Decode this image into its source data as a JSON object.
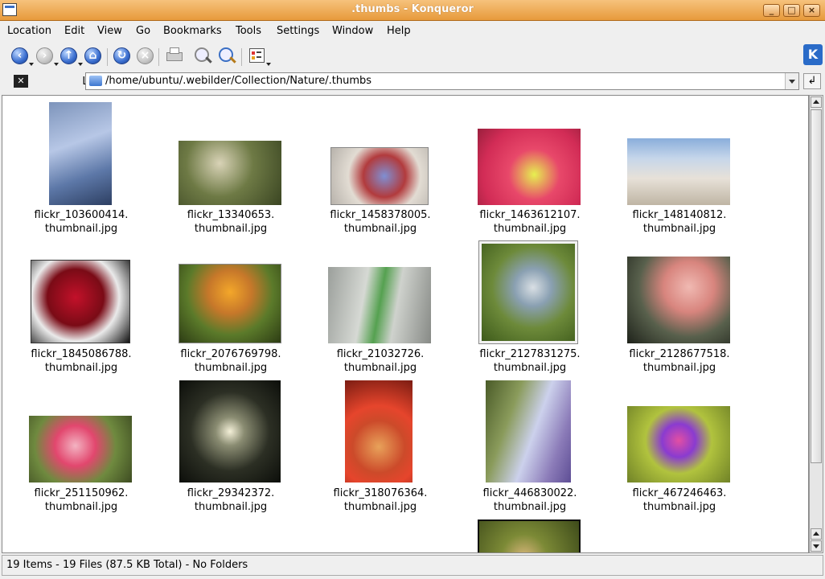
{
  "window": {
    "title": ".thumbs - Konqueror",
    "buttons": {
      "minimize": "_",
      "maximize": "□",
      "close": "×"
    }
  },
  "menu": [
    "Location",
    "Edit",
    "View",
    "Go",
    "Bookmarks",
    "Tools",
    "Settings",
    "Window",
    "Help"
  ],
  "toolbar": {
    "icons": [
      "back-icon",
      "forward-icon",
      "up-icon",
      "home-icon",
      "reload-icon",
      "stop-icon",
      "print-icon",
      "zoom-in-icon",
      "zoom-out-icon",
      "view-mode-icon"
    ]
  },
  "location": {
    "label": "Location:",
    "path": "/home/ubuntu/.webilder/Collection/Nature/.thumbs"
  },
  "files": [
    {
      "line1": "flickr_103600414.",
      "line2": "thumbnail.jpg"
    },
    {
      "line1": "flickr_13340653.",
      "line2": "thumbnail.jpg"
    },
    {
      "line1": "flickr_1458378005.",
      "line2": "thumbnail.jpg"
    },
    {
      "line1": "flickr_1463612107.",
      "line2": "thumbnail.jpg"
    },
    {
      "line1": "flickr_148140812.",
      "line2": "thumbnail.jpg"
    },
    {
      "line1": "flickr_1845086788.",
      "line2": "thumbnail.jpg"
    },
    {
      "line1": "flickr_2076769798.",
      "line2": "thumbnail.jpg"
    },
    {
      "line1": "flickr_21032726.",
      "line2": "thumbnail.jpg"
    },
    {
      "line1": "flickr_2127831275.",
      "line2": "thumbnail.jpg"
    },
    {
      "line1": "flickr_2128677518.",
      "line2": "thumbnail.jpg"
    },
    {
      "line1": "flickr_251150962.",
      "line2": "thumbnail.jpg"
    },
    {
      "line1": "flickr_29342372.",
      "line2": "thumbnail.jpg"
    },
    {
      "line1": "flickr_318076364.",
      "line2": "thumbnail.jpg"
    },
    {
      "line1": "flickr_446830022.",
      "line2": "thumbnail.jpg"
    },
    {
      "line1": "flickr_467246463.",
      "line2": "thumbnail.jpg"
    }
  ],
  "status": "19 Items - 19 Files (87.5 KB Total) - No Folders"
}
